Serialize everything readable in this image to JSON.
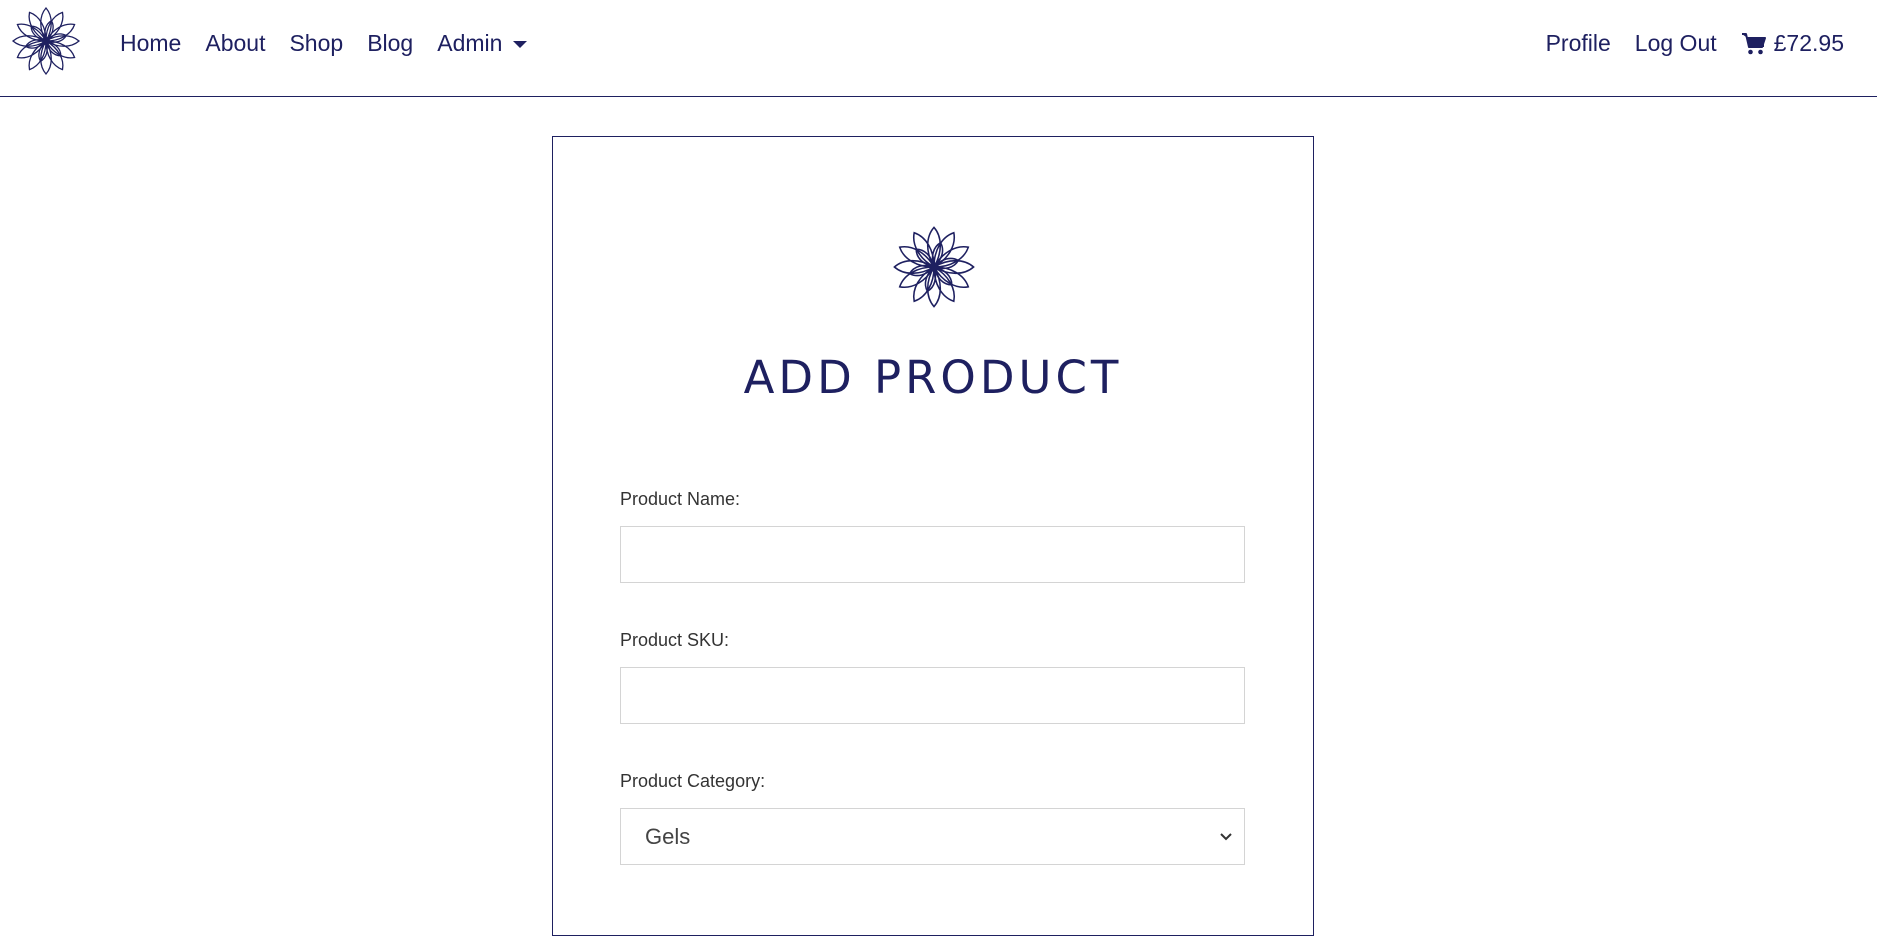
{
  "nav": {
    "brand_icon": "lotus-flower-icon",
    "links": {
      "home": "Home",
      "about": "About",
      "shop": "Shop",
      "blog": "Blog",
      "admin": "Admin"
    },
    "right": {
      "profile": "Profile",
      "logout": "Log Out",
      "cart_icon": "shopping-cart-icon",
      "cart_total": "£72.95"
    }
  },
  "form": {
    "logo_icon": "lotus-flower-icon",
    "title": "ADD PRODUCT",
    "product_name": {
      "label": "Product Name:",
      "value": "",
      "placeholder": ""
    },
    "product_sku": {
      "label": "Product SKU:",
      "value": "",
      "placeholder": ""
    },
    "product_category": {
      "label": "Product Category:",
      "selected": "Gels"
    }
  },
  "colors": {
    "accent": "#1e2060",
    "input_border": "#d4d4d4",
    "label_text": "#333333"
  }
}
